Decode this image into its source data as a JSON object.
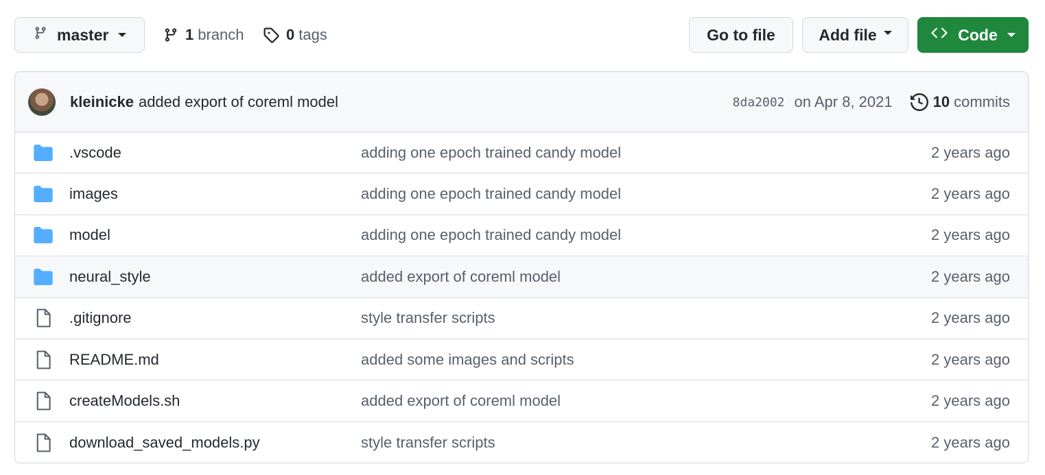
{
  "branch_selector": {
    "label": "master",
    "icon": "git-branch-icon"
  },
  "branches": {
    "count": "1",
    "label": "branch"
  },
  "tags": {
    "count": "0",
    "label": "tags"
  },
  "buttons": {
    "go_to_file": "Go to file",
    "add_file": "Add file",
    "code": "Code"
  },
  "colors": {
    "code_button": "#1f883d",
    "folder_icon": "#54aeff",
    "file_icon": "#57606a"
  },
  "latest_commit": {
    "author": "kleinicke",
    "message": "added export of coreml model",
    "sha": "8da2002",
    "date": "on Apr 8, 2021",
    "commits_count": "10",
    "commits_label": "commits"
  },
  "files": [
    {
      "type": "folder",
      "name": ".vscode",
      "message": "adding one epoch trained candy model",
      "age": "2 years ago"
    },
    {
      "type": "folder",
      "name": "images",
      "message": "adding one epoch trained candy model",
      "age": "2 years ago"
    },
    {
      "type": "folder",
      "name": "model",
      "message": "adding one epoch trained candy model",
      "age": "2 years ago"
    },
    {
      "type": "folder",
      "name": "neural_style",
      "message": "added export of coreml model",
      "age": "2 years ago"
    },
    {
      "type": "file",
      "name": ".gitignore",
      "message": "style transfer scripts",
      "age": "2 years ago"
    },
    {
      "type": "file",
      "name": "README.md",
      "message": "added some images and scripts",
      "age": "2 years ago"
    },
    {
      "type": "file",
      "name": "createModels.sh",
      "message": "added export of coreml model",
      "age": "2 years ago"
    },
    {
      "type": "file",
      "name": "download_saved_models.py",
      "message": "style transfer scripts",
      "age": "2 years ago"
    }
  ]
}
